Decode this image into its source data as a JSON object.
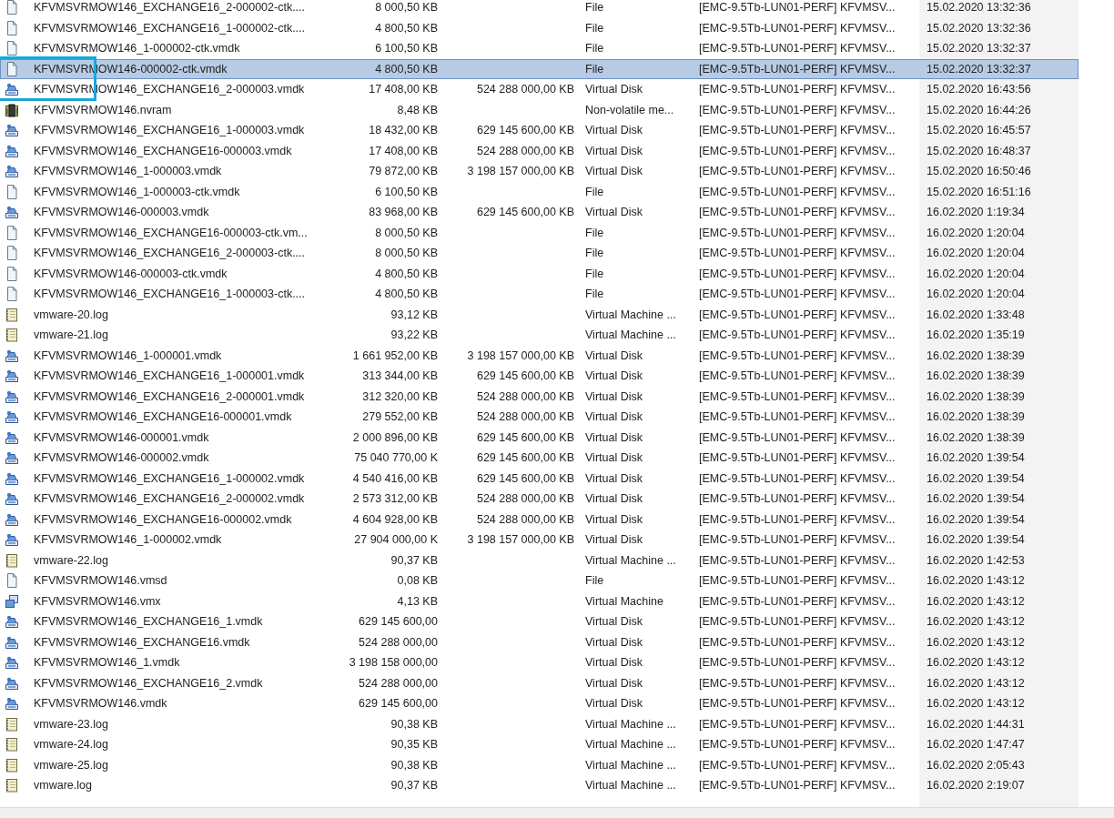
{
  "rows": [
    {
      "kind": "file",
      "name": "KFVMSVRMOW146_EXCHANGE16_2-000002-ctk....",
      "size": "8 000,50 KB",
      "type": "File",
      "path": "[EMC-9.5Tb-LUN01-PERF] KFVMSV...",
      "modified": "15.02.2020 13:32:36",
      "selected": false
    },
    {
      "kind": "file",
      "name": "KFVMSVRMOW146_EXCHANGE16_1-000002-ctk....",
      "size": "4 800,50 KB",
      "type": "File",
      "path": "[EMC-9.5Tb-LUN01-PERF] KFVMSV...",
      "modified": "15.02.2020 13:32:36",
      "selected": false
    },
    {
      "kind": "file",
      "name": "KFVMSVRMOW146_1-000002-ctk.vmdk",
      "size": "6 100,50 KB",
      "type": "File",
      "path": "[EMC-9.5Tb-LUN01-PERF] KFVMSV...",
      "modified": "15.02.2020 13:32:37",
      "selected": false
    },
    {
      "kind": "file",
      "name": "KFVMSVRMOW146-000002-ctk.vmdk",
      "size": "4 800,50 KB",
      "type": "File",
      "path": "[EMC-9.5Tb-LUN01-PERF] KFVMSV...",
      "modified": "15.02.2020 13:32:37",
      "selected": true
    },
    {
      "kind": "disk",
      "name": "KFVMSVRMOW146_EXCHANGE16_2-000003.vmdk",
      "size": "17 408,00 KB",
      "provisioned": "524 288 000,00 KB",
      "type": "Virtual Disk",
      "path": "[EMC-9.5Tb-LUN01-PERF] KFVMSV...",
      "modified": "15.02.2020 16:43:56",
      "selected": false
    },
    {
      "kind": "nvram",
      "name": "KFVMSVRMOW146.nvram",
      "size": "8,48 KB",
      "type": "Non-volatile me...",
      "path": "[EMC-9.5Tb-LUN01-PERF] KFVMSV...",
      "modified": "15.02.2020 16:44:26",
      "selected": false
    },
    {
      "kind": "disk",
      "name": "KFVMSVRMOW146_EXCHANGE16_1-000003.vmdk",
      "size": "18 432,00 KB",
      "provisioned": "629 145 600,00 KB",
      "type": "Virtual Disk",
      "path": "[EMC-9.5Tb-LUN01-PERF] KFVMSV...",
      "modified": "15.02.2020 16:45:57",
      "selected": false
    },
    {
      "kind": "disk",
      "name": "KFVMSVRMOW146_EXCHANGE16-000003.vmdk",
      "size": "17 408,00 KB",
      "provisioned": "524 288 000,00 KB",
      "type": "Virtual Disk",
      "path": "[EMC-9.5Tb-LUN01-PERF] KFVMSV...",
      "modified": "15.02.2020 16:48:37",
      "selected": false
    },
    {
      "kind": "disk",
      "name": "KFVMSVRMOW146_1-000003.vmdk",
      "size": "79 872,00 KB",
      "provisioned": "3 198 157 000,00 KB",
      "type": "Virtual Disk",
      "path": "[EMC-9.5Tb-LUN01-PERF] KFVMSV...",
      "modified": "15.02.2020 16:50:46",
      "selected": false
    },
    {
      "kind": "file",
      "name": "KFVMSVRMOW146_1-000003-ctk.vmdk",
      "size": "6 100,50 KB",
      "type": "File",
      "path": "[EMC-9.5Tb-LUN01-PERF] KFVMSV...",
      "modified": "15.02.2020 16:51:16",
      "selected": false
    },
    {
      "kind": "disk",
      "name": "KFVMSVRMOW146-000003.vmdk",
      "size": "83 968,00 KB",
      "provisioned": "629 145 600,00 KB",
      "type": "Virtual Disk",
      "path": "[EMC-9.5Tb-LUN01-PERF] KFVMSV...",
      "modified": "16.02.2020 1:19:34",
      "selected": false
    },
    {
      "kind": "file",
      "name": "KFVMSVRMOW146_EXCHANGE16-000003-ctk.vm...",
      "size": "8 000,50 KB",
      "type": "File",
      "path": "[EMC-9.5Tb-LUN01-PERF] KFVMSV...",
      "modified": "16.02.2020 1:20:04",
      "selected": false
    },
    {
      "kind": "file",
      "name": "KFVMSVRMOW146_EXCHANGE16_2-000003-ctk....",
      "size": "8 000,50 KB",
      "type": "File",
      "path": "[EMC-9.5Tb-LUN01-PERF] KFVMSV...",
      "modified": "16.02.2020 1:20:04",
      "selected": false
    },
    {
      "kind": "file",
      "name": "KFVMSVRMOW146-000003-ctk.vmdk",
      "size": "4 800,50 KB",
      "type": "File",
      "path": "[EMC-9.5Tb-LUN01-PERF] KFVMSV...",
      "modified": "16.02.2020 1:20:04",
      "selected": false
    },
    {
      "kind": "file",
      "name": "KFVMSVRMOW146_EXCHANGE16_1-000003-ctk....",
      "size": "4 800,50 KB",
      "type": "File",
      "path": "[EMC-9.5Tb-LUN01-PERF] KFVMSV...",
      "modified": "16.02.2020 1:20:04",
      "selected": false
    },
    {
      "kind": "log",
      "name": "vmware-20.log",
      "size": "93,12 KB",
      "type": "Virtual Machine ...",
      "path": "[EMC-9.5Tb-LUN01-PERF] KFVMSV...",
      "modified": "16.02.2020 1:33:48",
      "selected": false
    },
    {
      "kind": "log",
      "name": "vmware-21.log",
      "size": "93,22 KB",
      "type": "Virtual Machine ...",
      "path": "[EMC-9.5Tb-LUN01-PERF] KFVMSV...",
      "modified": "16.02.2020 1:35:19",
      "selected": false
    },
    {
      "kind": "disk",
      "name": "KFVMSVRMOW146_1-000001.vmdk",
      "size": "1 661 952,00 KB",
      "provisioned": "3 198 157 000,00 KB",
      "type": "Virtual Disk",
      "path": "[EMC-9.5Tb-LUN01-PERF] KFVMSV...",
      "modified": "16.02.2020 1:38:39",
      "selected": false
    },
    {
      "kind": "disk",
      "name": "KFVMSVRMOW146_EXCHANGE16_1-000001.vmdk",
      "size": "313 344,00 KB",
      "provisioned": "629 145 600,00 KB",
      "type": "Virtual Disk",
      "path": "[EMC-9.5Tb-LUN01-PERF] KFVMSV...",
      "modified": "16.02.2020 1:38:39",
      "selected": false
    },
    {
      "kind": "disk",
      "name": "KFVMSVRMOW146_EXCHANGE16_2-000001.vmdk",
      "size": "312 320,00 KB",
      "provisioned": "524 288 000,00 KB",
      "type": "Virtual Disk",
      "path": "[EMC-9.5Tb-LUN01-PERF] KFVMSV...",
      "modified": "16.02.2020 1:38:39",
      "selected": false
    },
    {
      "kind": "disk",
      "name": "KFVMSVRMOW146_EXCHANGE16-000001.vmdk",
      "size": "279 552,00 KB",
      "provisioned": "524 288 000,00 KB",
      "type": "Virtual Disk",
      "path": "[EMC-9.5Tb-LUN01-PERF] KFVMSV...",
      "modified": "16.02.2020 1:38:39",
      "selected": false
    },
    {
      "kind": "disk",
      "name": "KFVMSVRMOW146-000001.vmdk",
      "size": "2 000 896,00 KB",
      "provisioned": "629 145 600,00 KB",
      "type": "Virtual Disk",
      "path": "[EMC-9.5Tb-LUN01-PERF] KFVMSV...",
      "modified": "16.02.2020 1:38:39",
      "selected": false
    },
    {
      "kind": "disk",
      "name": "KFVMSVRMOW146-000002.vmdk",
      "size": "75 040 770,00 K",
      "provisioned": "629 145 600,00 KB",
      "type": "Virtual Disk",
      "path": "[EMC-9.5Tb-LUN01-PERF] KFVMSV...",
      "modified": "16.02.2020 1:39:54",
      "selected": false
    },
    {
      "kind": "disk",
      "name": "KFVMSVRMOW146_EXCHANGE16_1-000002.vmdk",
      "size": "4 540 416,00 KB",
      "provisioned": "629 145 600,00 KB",
      "type": "Virtual Disk",
      "path": "[EMC-9.5Tb-LUN01-PERF] KFVMSV...",
      "modified": "16.02.2020 1:39:54",
      "selected": false
    },
    {
      "kind": "disk",
      "name": "KFVMSVRMOW146_EXCHANGE16_2-000002.vmdk",
      "size": "2 573 312,00 KB",
      "provisioned": "524 288 000,00 KB",
      "type": "Virtual Disk",
      "path": "[EMC-9.5Tb-LUN01-PERF] KFVMSV...",
      "modified": "16.02.2020 1:39:54",
      "selected": false
    },
    {
      "kind": "disk",
      "name": "KFVMSVRMOW146_EXCHANGE16-000002.vmdk",
      "size": "4 604 928,00 KB",
      "provisioned": "524 288 000,00 KB",
      "type": "Virtual Disk",
      "path": "[EMC-9.5Tb-LUN01-PERF] KFVMSV...",
      "modified": "16.02.2020 1:39:54",
      "selected": false
    },
    {
      "kind": "disk",
      "name": "KFVMSVRMOW146_1-000002.vmdk",
      "size": "27 904 000,00 K",
      "provisioned": "3 198 157 000,00 KB",
      "type": "Virtual Disk",
      "path": "[EMC-9.5Tb-LUN01-PERF] KFVMSV...",
      "modified": "16.02.2020 1:39:54",
      "selected": false
    },
    {
      "kind": "log",
      "name": "vmware-22.log",
      "size": "90,37 KB",
      "type": "Virtual Machine ...",
      "path": "[EMC-9.5Tb-LUN01-PERF] KFVMSV...",
      "modified": "16.02.2020 1:42:53",
      "selected": false
    },
    {
      "kind": "file",
      "name": "KFVMSVRMOW146.vmsd",
      "size": "0,08 KB",
      "type": "File",
      "path": "[EMC-9.5Tb-LUN01-PERF] KFVMSV...",
      "modified": "16.02.2020 1:43:12",
      "selected": false
    },
    {
      "kind": "vmx",
      "name": "KFVMSVRMOW146.vmx",
      "size": "4,13 KB",
      "type": "Virtual Machine",
      "path": "[EMC-9.5Tb-LUN01-PERF] KFVMSV...",
      "modified": "16.02.2020 1:43:12",
      "selected": false
    },
    {
      "kind": "disk",
      "name": "KFVMSVRMOW146_EXCHANGE16_1.vmdk",
      "size": "629 145 600,00",
      "type": "Virtual Disk",
      "path": "[EMC-9.5Tb-LUN01-PERF] KFVMSV...",
      "modified": "16.02.2020 1:43:12",
      "selected": false
    },
    {
      "kind": "disk",
      "name": "KFVMSVRMOW146_EXCHANGE16.vmdk",
      "size": "524 288 000,00",
      "type": "Virtual Disk",
      "path": "[EMC-9.5Tb-LUN01-PERF] KFVMSV...",
      "modified": "16.02.2020 1:43:12",
      "selected": false
    },
    {
      "kind": "disk",
      "name": "KFVMSVRMOW146_1.vmdk",
      "size": "3 198 158 000,00",
      "type": "Virtual Disk",
      "path": "[EMC-9.5Tb-LUN01-PERF] KFVMSV...",
      "modified": "16.02.2020 1:43:12",
      "selected": false
    },
    {
      "kind": "disk",
      "name": "KFVMSVRMOW146_EXCHANGE16_2.vmdk",
      "size": "524 288 000,00",
      "type": "Virtual Disk",
      "path": "[EMC-9.5Tb-LUN01-PERF] KFVMSV...",
      "modified": "16.02.2020 1:43:12",
      "selected": false
    },
    {
      "kind": "disk",
      "name": "KFVMSVRMOW146.vmdk",
      "size": "629 145 600,00",
      "type": "Virtual Disk",
      "path": "[EMC-9.5Tb-LUN01-PERF] KFVMSV...",
      "modified": "16.02.2020 1:43:12",
      "selected": false
    },
    {
      "kind": "log",
      "name": "vmware-23.log",
      "size": "90,38 KB",
      "type": "Virtual Machine ...",
      "path": "[EMC-9.5Tb-LUN01-PERF] KFVMSV...",
      "modified": "16.02.2020 1:44:31",
      "selected": false
    },
    {
      "kind": "log",
      "name": "vmware-24.log",
      "size": "90,35 KB",
      "type": "Virtual Machine ...",
      "path": "[EMC-9.5Tb-LUN01-PERF] KFVMSV...",
      "modified": "16.02.2020 1:47:47",
      "selected": false
    },
    {
      "kind": "log",
      "name": "vmware-25.log",
      "size": "90,38 KB",
      "type": "Virtual Machine ...",
      "path": "[EMC-9.5Tb-LUN01-PERF] KFVMSV...",
      "modified": "16.02.2020 2:05:43",
      "selected": false
    },
    {
      "kind": "log",
      "name": "vmware.log",
      "size": "90,37 KB",
      "type": "Virtual Machine ...",
      "path": "[EMC-9.5Tb-LUN01-PERF] KFVMSV...",
      "modified": "16.02.2020 2:19:07",
      "selected": false
    }
  ]
}
